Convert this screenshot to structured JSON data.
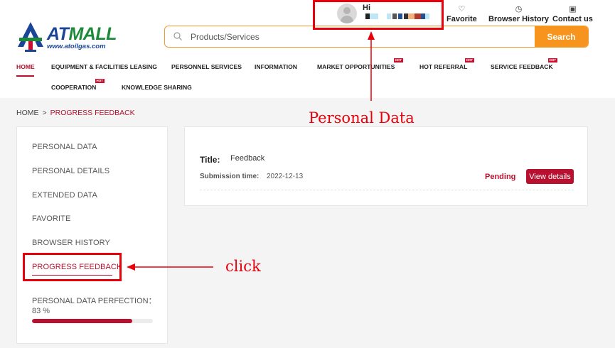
{
  "header": {
    "brand_at": "AT",
    "brand_mall": "MALL",
    "brand_url": "www.atoilgas.com",
    "greeting": "Hi",
    "links": {
      "favorite": "Favorite",
      "history": "Browser History",
      "contact": "Contact us"
    },
    "search": {
      "placeholder": "Products/Services",
      "button": "Search"
    },
    "hot_badge": "HOT"
  },
  "nav": {
    "home": "HOME",
    "equipment": "EQUIPMENT & FACILITIES LEASING",
    "personnel": "PERSONNEL SERVICES",
    "information": "INFORMATION",
    "market": "MARKET OPPORTUNITIES",
    "referral": "HOT REFERRAL",
    "feedback": "SERVICE FEEDBACK",
    "cooperation": "COOPERATION",
    "knowledge": "KNOWLEDGE SHARING"
  },
  "breadcrumb": {
    "home": "HOME",
    "separator": ">",
    "current": "PROGRESS FEEDBACK"
  },
  "sidebar": {
    "items": [
      "PERSONAL DATA",
      "PERSONAL DETAILS",
      "EXTENDED DATA",
      "FAVORITE",
      "BROWSER HISTORY",
      "PROGRESS FEEDBACK"
    ],
    "active_index": 5,
    "perfection_label": "PERSONAL DATA PERFECTION：",
    "perfection_value": "83 %",
    "perfection_fraction": 0.83
  },
  "feedback": {
    "title_label": "Title:",
    "title_value": "Feedback",
    "time_label": "Submission time:",
    "time_value": "2022-12-13",
    "status": "Pending",
    "details_button": "View details"
  },
  "annotations": {
    "personal_data": "Personal Data",
    "click": "click"
  },
  "colors": {
    "accent": "#b8102f",
    "search_orange": "#f7941d",
    "annotation_red": "#e8000b",
    "brand_blue": "#1b4597",
    "brand_green": "#1d8a3a"
  }
}
